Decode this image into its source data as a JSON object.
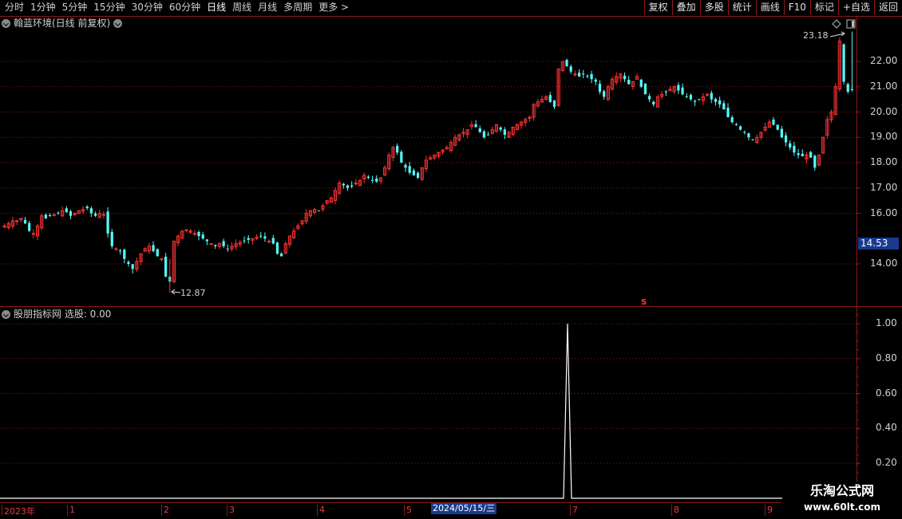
{
  "toolbar": {
    "periods": [
      "分时",
      "1分钟",
      "5分钟",
      "15分钟",
      "30分钟",
      "60分钟",
      "日线",
      "周线",
      "月线",
      "多周期",
      "更多 >"
    ],
    "active_period": "日线",
    "buttons": [
      "复权",
      "叠加",
      "多股",
      "统计",
      "画线",
      "F10",
      "标记",
      "+自选",
      "返回"
    ]
  },
  "main_pane": {
    "title": "翰蓝环境(日线 前复权)",
    "y_ticks": [
      "22.00",
      "21.00",
      "20.00",
      "19.00",
      "18.00",
      "17.00",
      "16.00",
      "14.00"
    ],
    "current_price": "14.53",
    "high_label": "23.18",
    "low_label": "12.87",
    "marker": "s"
  },
  "sub_pane": {
    "title": "股朋指标网 选股: 0.00",
    "y_ticks": [
      "1.00",
      "0.80",
      "0.60",
      "0.40",
      "0.20"
    ]
  },
  "date_axis": {
    "labels": [
      "2023年",
      "1",
      "2",
      "3",
      "4",
      "5",
      "7",
      "8",
      "9"
    ],
    "highlight": "2024/05/15/三"
  },
  "watermark": {
    "title": "乐淘公式网",
    "url": "www.60lt.com"
  },
  "colors": {
    "up": "#ff3232",
    "down": "#54fcfc",
    "grid": "#8b1a1a",
    "highlight": "#1a3a8f"
  },
  "chart_data": {
    "type": "candlestick",
    "main": {
      "ylim": [
        12.5,
        23.3
      ],
      "closes": [
        15.5,
        15.6,
        15.7,
        15.7,
        15.8,
        15.6,
        15.3,
        15.2,
        15.5,
        15.9,
        15.8,
        15.9,
        15.95,
        16.0,
        16.1,
        16.05,
        15.9,
        16.0,
        16.1,
        16.15,
        16.2,
        16.0,
        15.9,
        16.0,
        15.95,
        15.2,
        14.7,
        14.6,
        14.5,
        14.2,
        14.0,
        13.8,
        14.1,
        14.4,
        14.6,
        14.7,
        14.5,
        14.3,
        14.2,
        13.5,
        13.3,
        14.9,
        15.1,
        15.3,
        15.35,
        15.3,
        15.2,
        15.1,
        15.0,
        14.9,
        14.8,
        14.7,
        14.8,
        14.7,
        14.6,
        14.7,
        14.8,
        14.85,
        14.9,
        14.95,
        15.0,
        15.05,
        15.1,
        15.0,
        14.9,
        14.8,
        14.4,
        14.3,
        14.8,
        15.1,
        15.3,
        15.5,
        15.7,
        16.0,
        16.1,
        16.15,
        16.1,
        16.3,
        16.5,
        16.6,
        16.9,
        17.2,
        17.1,
        17.0,
        17.05,
        17.2,
        17.3,
        17.5,
        17.4,
        17.3,
        17.25,
        17.4,
        17.8,
        18.3,
        18.6,
        18.4,
        18.0,
        17.8,
        17.6,
        17.5,
        17.4,
        17.8,
        18.1,
        18.2,
        18.3,
        18.4,
        18.5,
        18.6,
        18.8,
        19.0,
        19.1,
        19.2,
        19.3,
        19.5,
        19.4,
        19.2,
        19.0,
        19.1,
        19.3,
        19.5,
        19.3,
        19.1,
        19.2,
        19.4,
        19.5,
        19.6,
        19.7,
        19.8,
        20.3,
        20.4,
        20.5,
        20.6,
        20.4,
        20.2,
        21.7,
        22.0,
        21.8,
        21.6,
        21.5,
        21.4,
        21.5,
        21.4,
        21.3,
        21.2,
        20.8,
        20.6,
        21.0,
        21.3,
        21.4,
        21.5,
        21.3,
        21.1,
        21.2,
        21.4,
        21.0,
        20.7,
        20.5,
        20.3,
        20.6,
        20.7,
        20.8,
        20.9,
        21.0,
        20.85,
        20.7,
        20.6,
        20.5,
        20.4,
        20.5,
        20.6,
        20.7,
        20.5,
        20.4,
        20.3,
        20.1,
        19.8,
        19.6,
        19.5,
        19.3,
        19.2,
        19.0,
        18.9,
        19.0,
        19.2,
        19.4,
        19.6,
        19.5,
        19.3,
        19.0,
        18.8,
        18.6,
        18.4,
        18.3,
        18.25,
        18.3,
        18.2,
        17.8,
        18.3,
        19.0,
        19.7,
        20.0,
        21.0,
        22.8,
        21.2,
        20.8,
        20.9
      ],
      "high": 23.18,
      "low": 12.87,
      "current": 14.53
    },
    "indicator": {
      "name": "选股",
      "value": 0.0,
      "ylim": [
        0,
        1.1
      ],
      "spike_index": 152,
      "spike_value": 1.0
    }
  }
}
